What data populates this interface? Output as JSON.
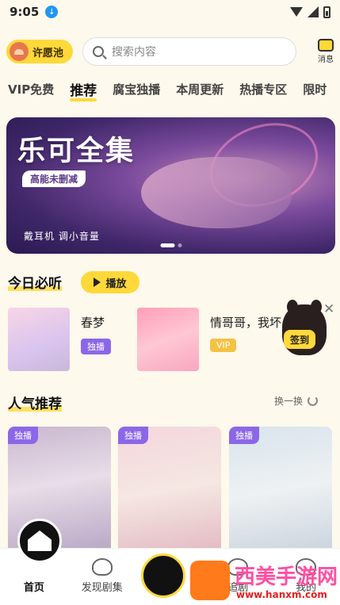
{
  "status": {
    "time": "9:05"
  },
  "header": {
    "wish_label": "许愿池",
    "search_placeholder": "搜索内容",
    "msg_label": "消息"
  },
  "tabs": [
    "VIP免费",
    "推荐",
    "腐宝独播",
    "本周更新",
    "热播专区",
    "限时"
  ],
  "banner": {
    "title": "乐可全集",
    "tag": "高能未删减",
    "subtitle": "戴耳机 调小音量"
  },
  "today": {
    "title": "今日必听",
    "play_label": "播放",
    "items": [
      {
        "name": "春梦",
        "badge": "独播"
      },
      {
        "name": "情哥哥，我坏",
        "badge": "VIP"
      }
    ],
    "checkin_label": "签到"
  },
  "popular": {
    "title": "人气推荐",
    "refresh_label": "换一换",
    "items": [
      {
        "badge": "独播"
      },
      {
        "badge": "独播"
      },
      {
        "badge": "独播"
      }
    ]
  },
  "nav": [
    "首页",
    "发现剧集",
    "",
    "追剧",
    "我的"
  ],
  "watermark": {
    "text": "西美手游网",
    "url": "www.hanxm.com"
  },
  "colors": {
    "accent": "#ffd83a",
    "badge_purple": "#8b67e8",
    "background": "#fdf9ec"
  }
}
